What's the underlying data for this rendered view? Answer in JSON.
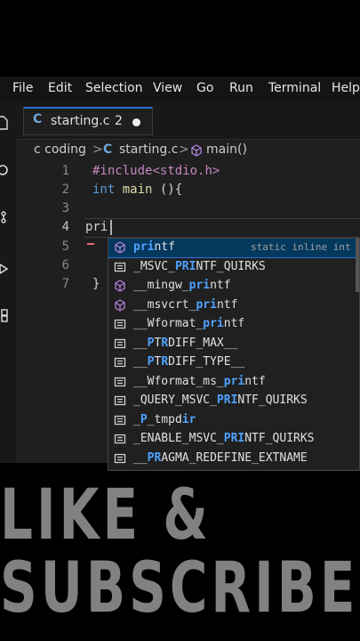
{
  "menubar": {
    "items": [
      "File",
      "Edit",
      "Selection",
      "View",
      "Go",
      "Run",
      "Terminal",
      "Help"
    ]
  },
  "activity_bar": {
    "icons": [
      "explorer-icon",
      "search-icon",
      "source-control-icon",
      "run-debug-icon",
      "extensions-icon"
    ]
  },
  "tab": {
    "icon_glyph": "C",
    "filename": "starting.c",
    "problem_count": "2",
    "unsaved": true
  },
  "breadcrumb": {
    "folder": "c coding",
    "sep1": ">",
    "file_icon": "C",
    "file": "starting.c",
    "sep2": ">",
    "symbol": "main()"
  },
  "editor": {
    "line_numbers": [
      "1",
      "2",
      "3",
      "4",
      "5",
      "6",
      "7"
    ],
    "active_line": "4",
    "line1": {
      "directive": "#include",
      "header": "<stdio.h>"
    },
    "line2": {
      "type": "int",
      "name": "main",
      "rest": " (){"
    },
    "line4": {
      "typed": "pri"
    },
    "line7": {
      "text": "}"
    }
  },
  "suggestions": {
    "query": "pri",
    "selected_detail": "static inline int",
    "items": [
      {
        "kind": "cube-icon",
        "pre": "",
        "match": "pri",
        "post": "ntf"
      },
      {
        "kind": "snippet-icon",
        "pre": "_MSVC_",
        "match": "PRI",
        "post": "NTF_QUIRKS"
      },
      {
        "kind": "cube-icon",
        "pre": "__mingw_",
        "match": "pri",
        "post": "ntf"
      },
      {
        "kind": "cube-icon",
        "pre": "__msvcrt_",
        "match": "pri",
        "post": "ntf"
      },
      {
        "kind": "snippet-icon",
        "pre": "__Wformat_",
        "match": "pri",
        "post": "ntf"
      },
      {
        "kind": "snippet-icon",
        "pre": "__",
        "match": "P",
        "post": "T",
        "match2": "R",
        "post2": "DIFF_MAX__"
      },
      {
        "kind": "snippet-icon",
        "pre": "__",
        "match": "P",
        "post": "T",
        "match2": "R",
        "post2": "DIFF_TYPE__"
      },
      {
        "kind": "snippet-icon",
        "pre": "__Wformat_ms_",
        "match": "pri",
        "post": "ntf"
      },
      {
        "kind": "snippet-icon",
        "pre": "_QUERY_MSVC_",
        "match": "PRI",
        "post": "NTF_QUIRKS"
      },
      {
        "kind": "snippet-icon",
        "pre": "_",
        "match": "P",
        "post": "_tmpd",
        "match2": "ir",
        "post2": ""
      },
      {
        "kind": "snippet-icon",
        "pre": "_ENABLE_MSVC_",
        "match": "PRI",
        "post": "NTF_QUIRKS"
      },
      {
        "kind": "snippet-icon",
        "pre": "__",
        "match": "PR",
        "post": "AGMA_REDEFINE_EXTNAME"
      }
    ]
  },
  "overlay": {
    "line1": "LIKE &",
    "line2": "SUBSCRIBE"
  },
  "colors": {
    "accent": "#2a6fd6",
    "match": "#4fa2ff",
    "cube_icon": "#b180d7",
    "editor_bg": "#1f1f1f"
  }
}
